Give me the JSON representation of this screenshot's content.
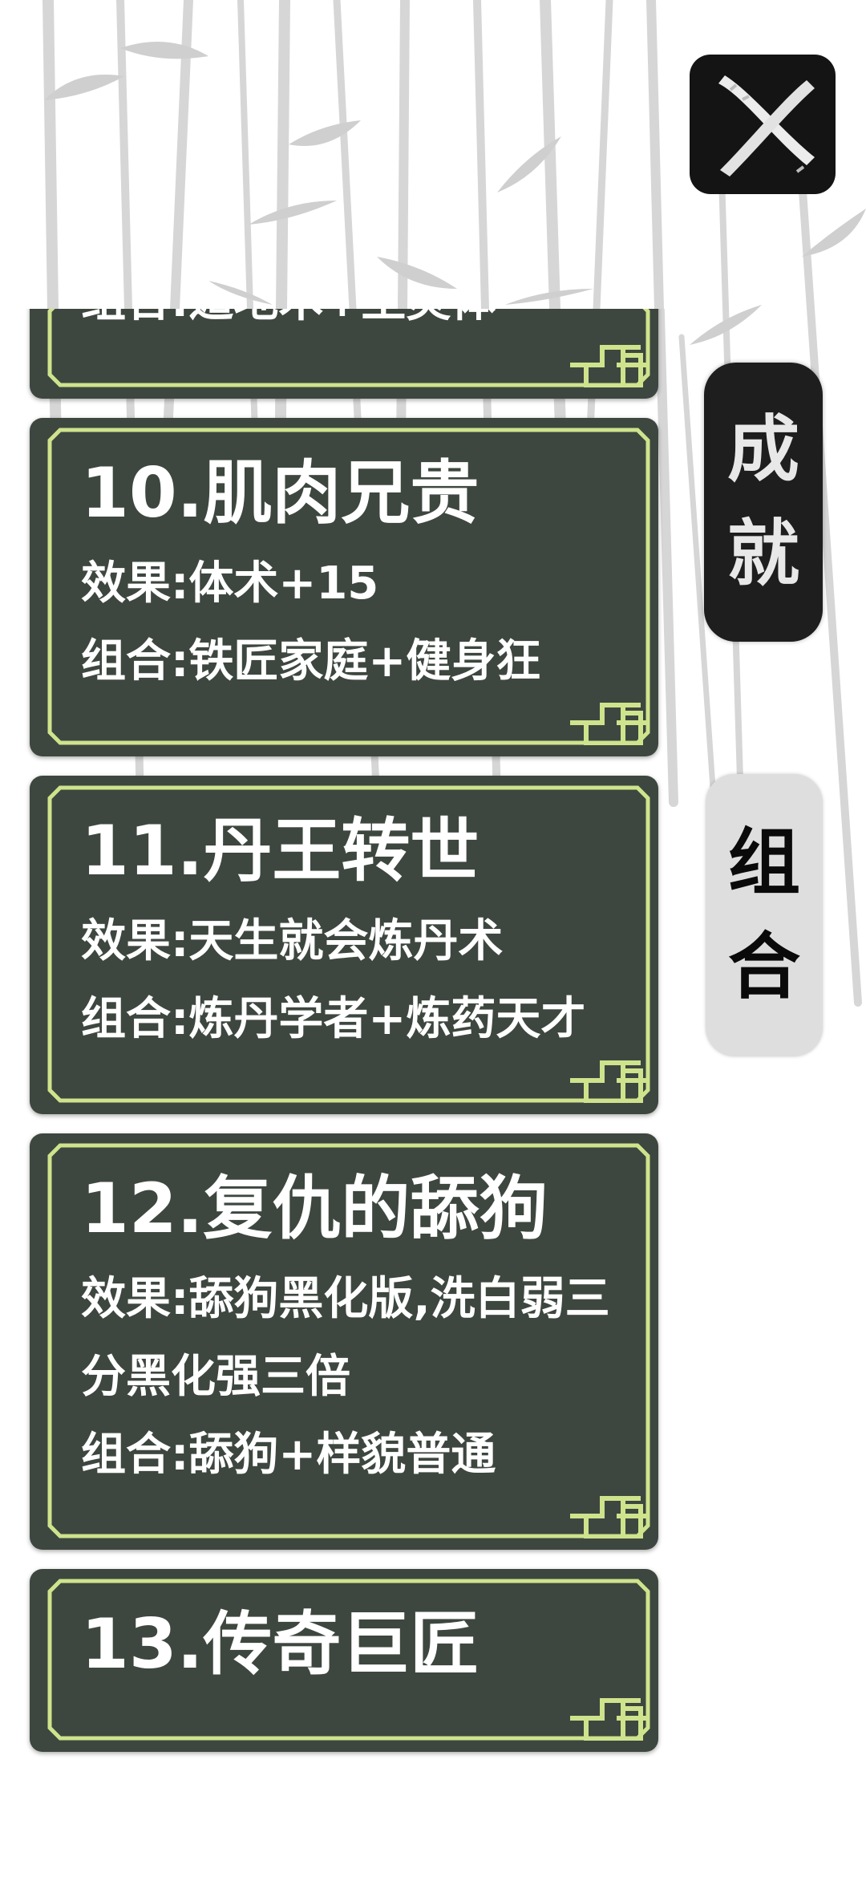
{
  "cards": [
    {
      "title": "",
      "lines": [
        {
          "label": "组合:",
          "text": "遁地术+土灵体"
        }
      ]
    },
    {
      "title": "10.肌肉兄贵",
      "lines": [
        {
          "label": "效果:",
          "text": "体术+15"
        },
        {
          "label": "组合:",
          "text": "铁匠家庭+健身狂"
        }
      ]
    },
    {
      "title": "11.丹王转世",
      "lines": [
        {
          "label": "效果:",
          "text": "天生就会炼丹术"
        },
        {
          "label": "组合:",
          "text": "炼丹学者+炼药天才"
        }
      ]
    },
    {
      "title": "12.复仇的舔狗",
      "lines": [
        {
          "label": "效果:",
          "text": "舔狗黑化版,洗白弱三分黑化强三倍"
        },
        {
          "label": "组合:",
          "text": "舔狗+样貌普通"
        }
      ]
    },
    {
      "title": "13.传奇巨匠",
      "lines": []
    }
  ],
  "tabs": {
    "achievements": [
      "成",
      "就"
    ],
    "combos": [
      "组",
      "合"
    ]
  },
  "icons": {
    "close": "close-x-icon",
    "card_corner": "lattice-corner-icon",
    "background": "bamboo-background"
  },
  "colors": {
    "card_bg": "#3d473f",
    "card_border": "#cfe38d",
    "card_text": "#ffffff",
    "tab_active_bg": "#1e1e1e",
    "tab_inactive_bg": "#dedede"
  }
}
